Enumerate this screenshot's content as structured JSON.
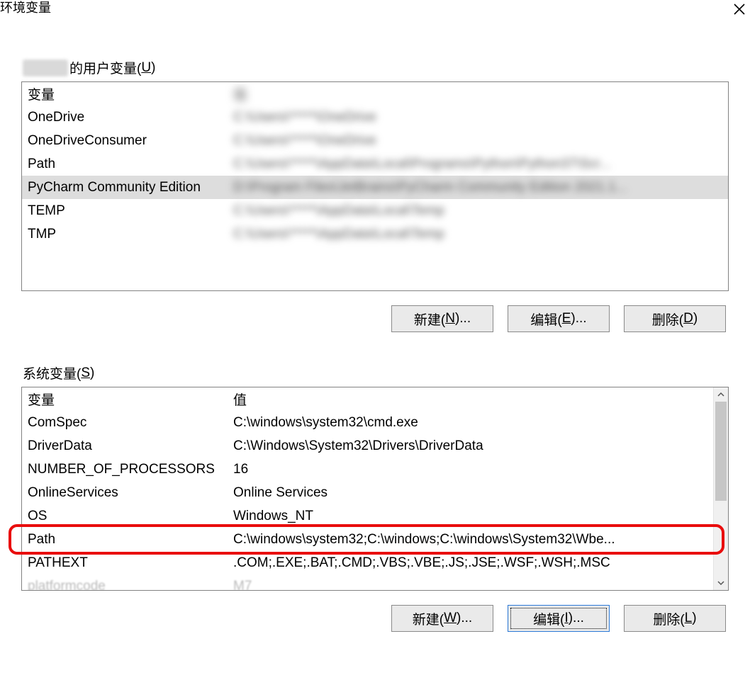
{
  "window": {
    "title": "环境变量"
  },
  "user_section": {
    "label_suffix": " 的用户变量(",
    "label_accel": "U",
    "label_end": ")",
    "columns": {
      "var": "变量",
      "val": "值"
    },
    "rows": [
      {
        "var": "OneDrive",
        "val": "C:\\Users\\*****\\OneDrive",
        "blur": true
      },
      {
        "var": "OneDriveConsumer",
        "val": "C:\\Users\\*****\\OneDrive",
        "blur": true
      },
      {
        "var": "Path",
        "val": "C:\\Users\\*****\\AppData\\Local\\Programs\\Python\\Python37\\Scr...",
        "blur": true
      },
      {
        "var": "PyCharm Community Edition",
        "val": "D:\\Program Files\\JetBrains\\PyCharm Community Edition 2021.1...",
        "blur": true,
        "selected": true
      },
      {
        "var": "TEMP",
        "val": "C:\\Users\\*****\\AppData\\Local\\Temp",
        "blur": true
      },
      {
        "var": "TMP",
        "val": "C:\\Users\\*****\\AppData\\Local\\Temp",
        "blur": true
      }
    ],
    "buttons": {
      "new": {
        "text": "新建(",
        "accel": "N",
        "end": ")..."
      },
      "edit": {
        "text": "编辑(",
        "accel": "E",
        "end": ")..."
      },
      "delete": {
        "text": "删除(",
        "accel": "D",
        "end": ")"
      }
    }
  },
  "system_section": {
    "label": "系统变量(",
    "label_accel": "S",
    "label_end": ")",
    "columns": {
      "var": "变量",
      "val": "值"
    },
    "rows": [
      {
        "var": "ComSpec",
        "val": "C:\\windows\\system32\\cmd.exe"
      },
      {
        "var": "DriverData",
        "val": "C:\\Windows\\System32\\Drivers\\DriverData"
      },
      {
        "var": "NUMBER_OF_PROCESSORS",
        "val": "16"
      },
      {
        "var": "OnlineServices",
        "val": "Online Services"
      },
      {
        "var": "OS",
        "val": "Windows_NT"
      },
      {
        "var": "Path",
        "val": "C:\\windows\\system32;C:\\windows;C:\\windows\\System32\\Wbe...",
        "highlight": true
      },
      {
        "var": "PATHEXT",
        "val": ".COM;.EXE;.BAT;.CMD;.VBS;.VBE;.JS;.JSE;.WSF;.WSH;.MSC"
      }
    ],
    "buttons": {
      "new": {
        "text": "新建(",
        "accel": "W",
        "end": ")..."
      },
      "edit": {
        "text": "编辑(",
        "accel": "I",
        "end": ")...",
        "focus": true
      },
      "delete": {
        "text": "删除(",
        "accel": "L",
        "end": ")"
      }
    }
  }
}
